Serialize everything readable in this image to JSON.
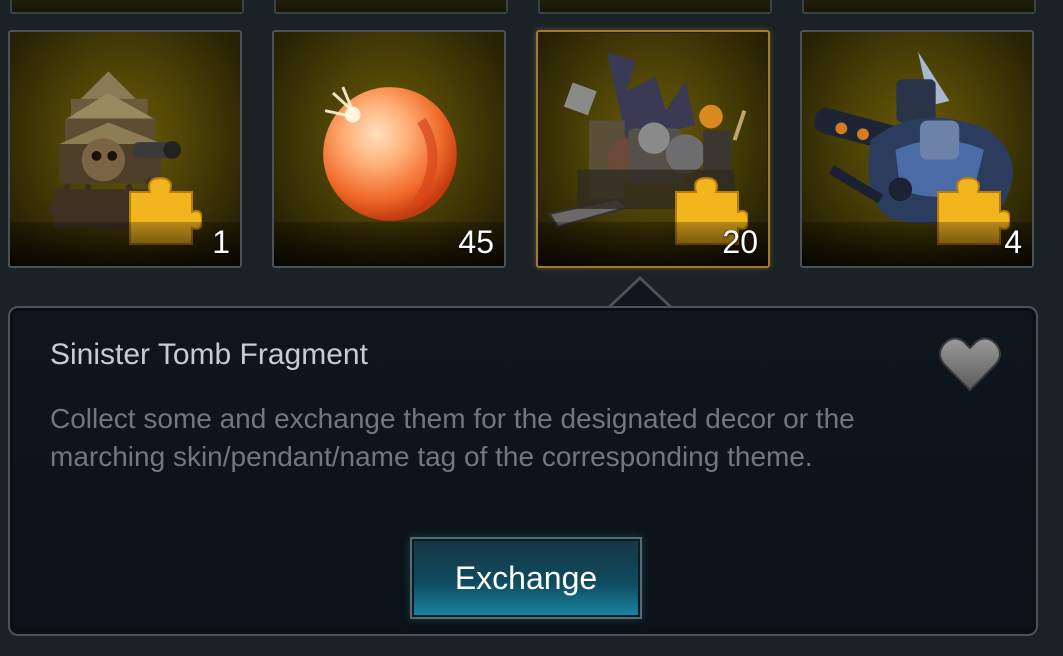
{
  "inventory": {
    "items": [
      {
        "name": "Castle Fragment",
        "count": "1",
        "icon": "castle-fragment-icon"
      },
      {
        "name": "Orb",
        "count": "45",
        "icon": "orange-orb-icon"
      },
      {
        "name": "Sinister Tomb Fragment",
        "count": "20",
        "icon": "tomb-fragment-icon",
        "selected": true
      },
      {
        "name": "Mech Fragment",
        "count": "4",
        "icon": "mech-fragment-icon"
      }
    ]
  },
  "detail": {
    "title": "Sinister Tomb Fragment",
    "description": "Collect some and exchange them for the designated decor or the marching skin/pendant/name tag of the corresponding theme.",
    "exchange_label": "Exchange"
  },
  "colors": {
    "slot_bg": "#4d4206",
    "selected_border": "#a37a2a",
    "panel_bg": "#0e161d",
    "button_accent": "#1a86a3"
  }
}
